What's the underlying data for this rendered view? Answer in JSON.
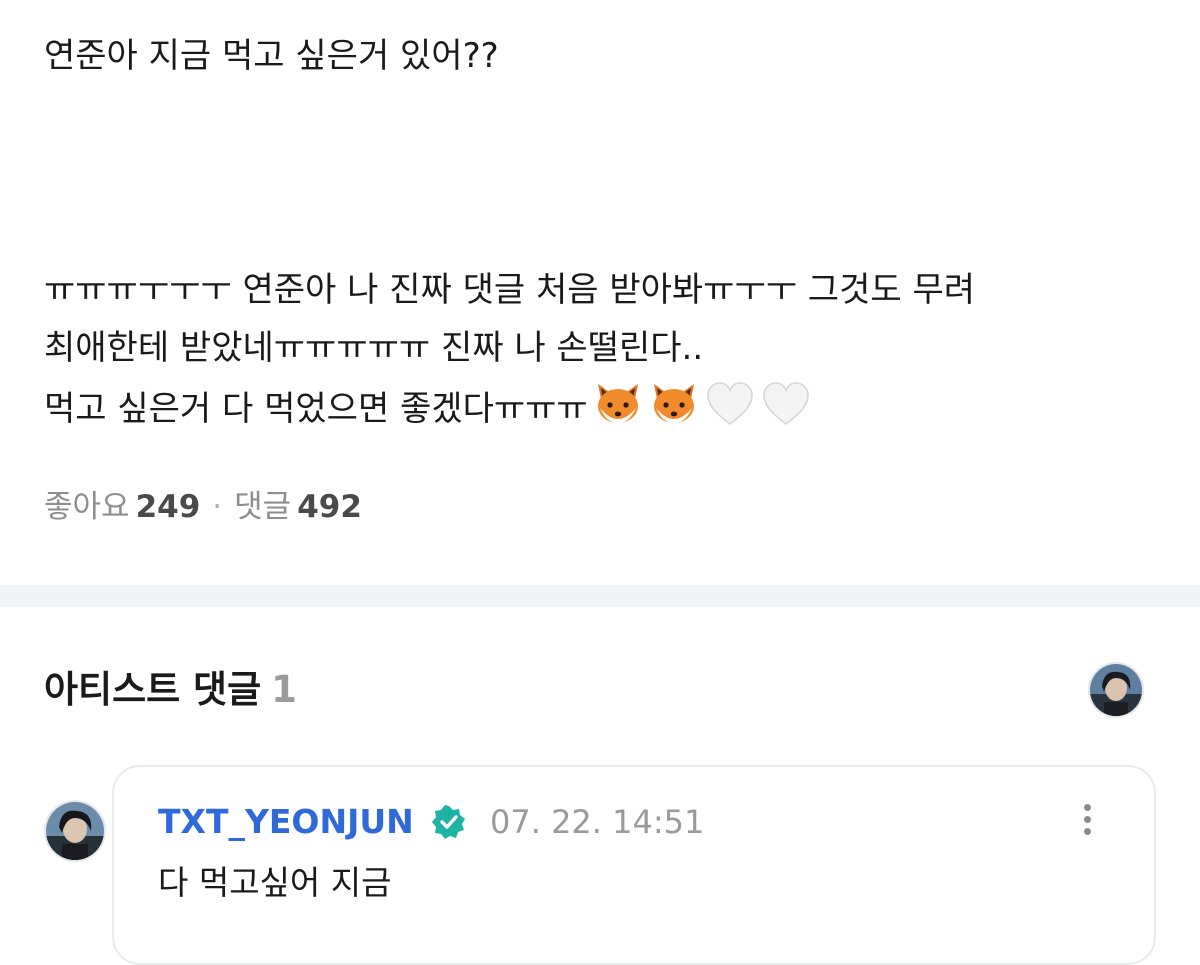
{
  "post": {
    "line1": "연준아 지금 먹고 싶은거 있어??",
    "line2": "ㅠㅠㅠㅜㅜㅜ 연준아 나 진짜 댓글 처음 받아봐ㅠㅜㅜ 그것도 무려",
    "line3": "최애한테 받았네ㅠㅠㅠㅠㅠ 진짜 나 손떨린다..",
    "line4_text": "먹고 싶은거 다 먹었으면 좋겠다ㅠㅠㅠ",
    "line4_emojis": [
      "fox-face-emoji",
      "fox-face-emoji",
      "white-heart-emoji",
      "white-heart-emoji"
    ]
  },
  "stats": {
    "likes_label": "좋아요",
    "likes_count": "249",
    "separator": "·",
    "comments_label": "댓글",
    "comments_count": "492"
  },
  "artist_comments": {
    "title": "아티스트 댓글",
    "count": "1"
  },
  "comment": {
    "author": "TXT_YEONJUN",
    "timestamp": "07. 22. 14:51",
    "text": "다 먹고싶어 지금",
    "verified_icon": "verified-badge-icon",
    "more_icon": "more-vertical-icon"
  },
  "colors": {
    "author": "#2f6bd8",
    "muted": "#9a9a9a",
    "divider": "#f2f3f5",
    "verified": "#1fb3a6"
  }
}
